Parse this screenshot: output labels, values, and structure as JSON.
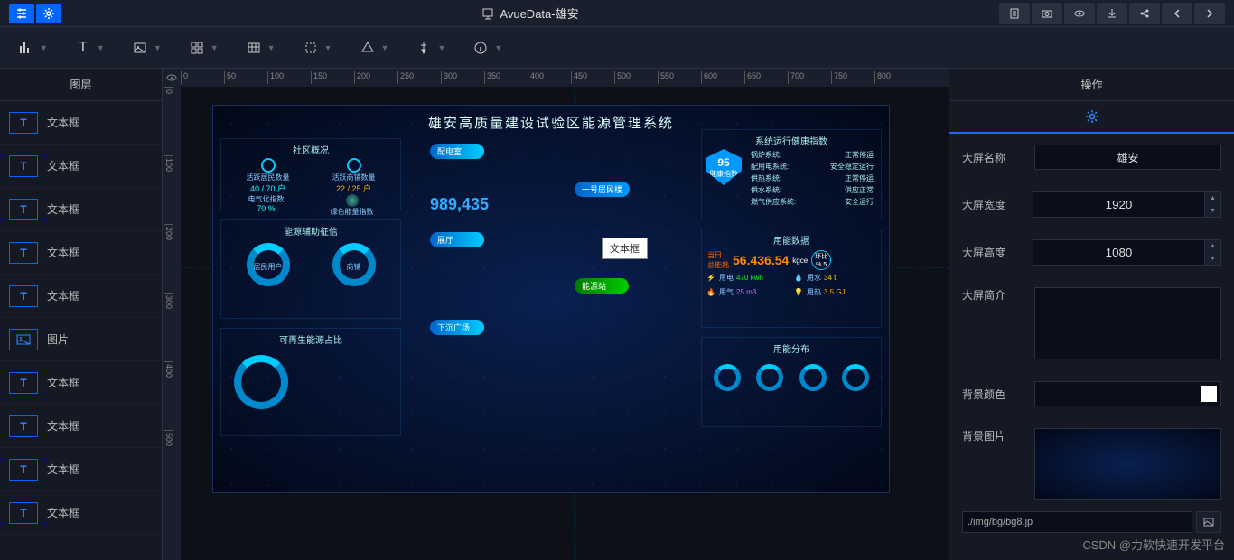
{
  "app_title": "AvueData-雄安",
  "left_panel": {
    "title": "图层",
    "items": [
      {
        "icon": "T",
        "label": "文本框"
      },
      {
        "icon": "T",
        "label": "文本框"
      },
      {
        "icon": "T",
        "label": "文本框"
      },
      {
        "icon": "T",
        "label": "文本框"
      },
      {
        "icon": "T",
        "label": "文本框"
      },
      {
        "icon": "IMG",
        "label": "图片"
      },
      {
        "icon": "T",
        "label": "文本框"
      },
      {
        "icon": "T",
        "label": "文本框"
      },
      {
        "icon": "T",
        "label": "文本框"
      },
      {
        "icon": "T",
        "label": "文本框"
      }
    ]
  },
  "ruler_h": [
    "0",
    "50",
    "100",
    "150",
    "200",
    "250",
    "300",
    "350",
    "400",
    "450",
    "500",
    "550",
    "600",
    "650",
    "700",
    "750",
    "800"
  ],
  "ruler_v": [
    "0",
    "100",
    "200",
    "300",
    "400",
    "500"
  ],
  "dashboard": {
    "title": "雄安高质量建设试验区能源管理系统",
    "community": {
      "title": "社区概况",
      "stats": [
        {
          "label": "活跃居民数量",
          "value": "40 / 70 户"
        },
        {
          "label": "活跃商铺数量",
          "value": "22 / 25 户"
        },
        {
          "label": "电气化指数",
          "value": "70 %"
        },
        {
          "label": "绿色能量指数",
          "value": ""
        }
      ]
    },
    "energy_aux": {
      "title": "能源辅助征信",
      "label1": "居民用户",
      "label2": "商铺"
    },
    "renewable": {
      "title": "可再生能源占比"
    },
    "center_num": "989,435",
    "pills": [
      "配电室",
      "展厅",
      "下沉广场"
    ],
    "pills2": [
      "一号居民楼",
      "能源站"
    ],
    "textbox_overlay": "文本框",
    "health": {
      "title": "系统运行健康指数",
      "score": "95",
      "score_label": "健康指数",
      "rows": [
        {
          "l": "锅炉系统:",
          "r": "正常停运"
        },
        {
          "l": "配用电系统:",
          "r": "安全稳定运行"
        },
        {
          "l": "供热系统:",
          "r": "正常停运"
        },
        {
          "l": "供水系统:",
          "r": "供应正常"
        },
        {
          "l": "燃气供应系统:",
          "r": "安全运行"
        }
      ]
    },
    "usage": {
      "title": "用能数据",
      "today_label": "当日\n总能耗",
      "total": "56.436.54",
      "total_unit": "kgce",
      "ratio_label": "环比",
      "ratio": "% 5",
      "items": [
        {
          "label": "用电",
          "value": "470 kwh",
          "color": "#0f0"
        },
        {
          "label": "用水",
          "value": "34 t",
          "color": "#fc0"
        },
        {
          "label": "用气",
          "value": "25 m3",
          "color": "#c6f"
        },
        {
          "label": "用热",
          "value": "3.5 GJ",
          "color": "#fa0"
        }
      ]
    },
    "dist": {
      "title": "用能分布"
    }
  },
  "right_panel": {
    "title": "操作",
    "props": {
      "name_label": "大屏名称",
      "name_value": "雄安",
      "width_label": "大屏宽度",
      "width_value": "1920",
      "height_label": "大屏高度",
      "height_value": "1080",
      "desc_label": "大屏简介",
      "bgcolor_label": "背景颜色",
      "bgimg_label": "背景图片",
      "bgimg_path": "./img/bg/bg8.jp"
    }
  },
  "watermark": "CSDN @力软快速开发平台"
}
